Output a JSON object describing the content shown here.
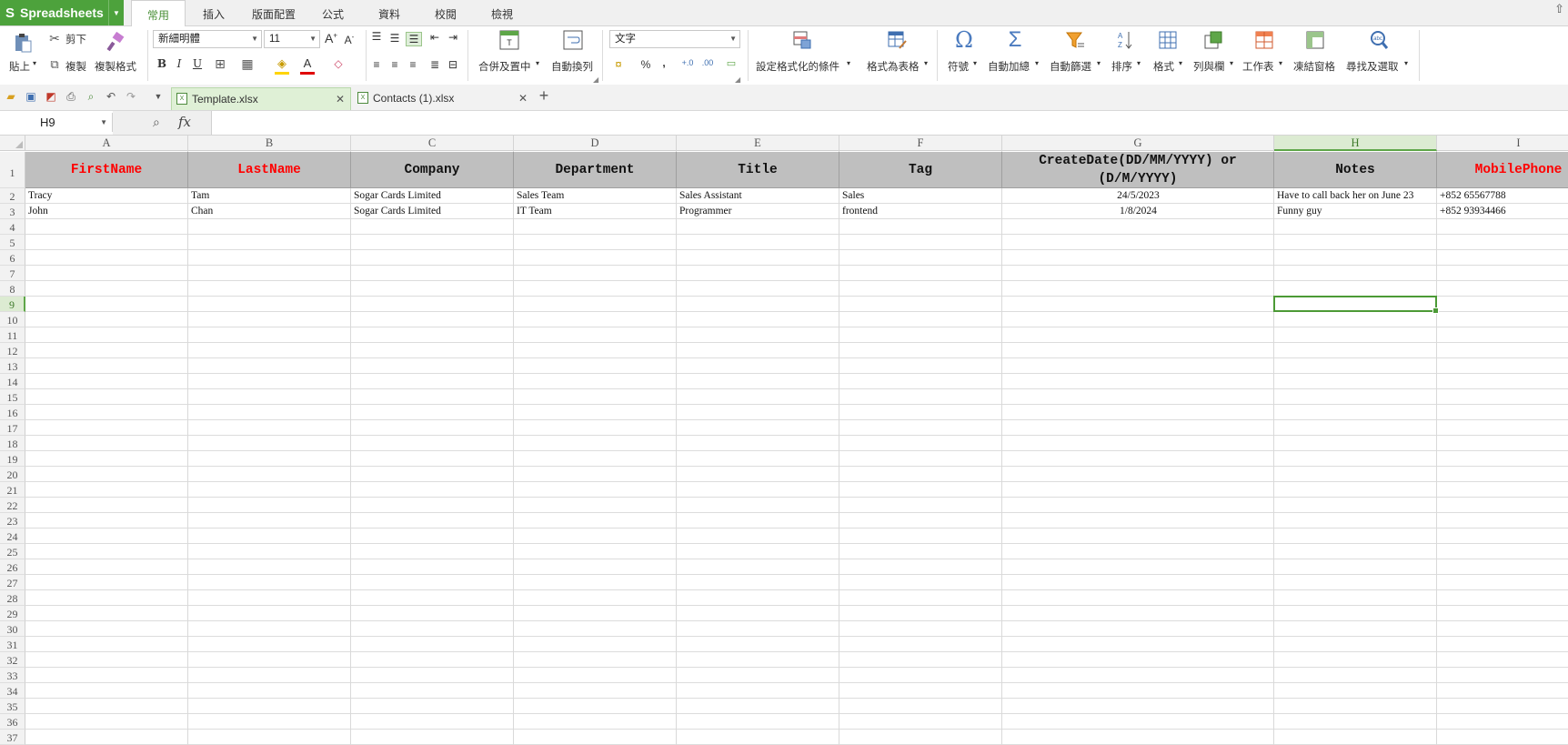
{
  "app": {
    "name": "Spreadsheets"
  },
  "menu_tabs": [
    "常用",
    "插入",
    "版面配置",
    "公式",
    "資料",
    "校閱",
    "檢視"
  ],
  "ribbon": {
    "paste": "貼上",
    "cut": "剪下",
    "copy": "複製",
    "format_painter": "複製格式",
    "font_name": "新細明體",
    "font_size": "11",
    "merge_center": "合併及置中",
    "wrap_text": "自動換列",
    "number_format": "文字",
    "percent": "%",
    "comma": ",",
    "conditional_format": "設定格式化的條件",
    "format_as_table": "格式為表格",
    "symbol": "符號",
    "autosum": "自動加總",
    "autofilter": "自動篩選",
    "sort": "排序",
    "format": "格式",
    "rows_cols": "列與欄",
    "worksheet": "工作表",
    "freeze": "凍結窗格",
    "find_select": "尋找及選取",
    "bold": "B",
    "italic": "I",
    "underline": "U"
  },
  "doc_tabs": [
    {
      "name": "Template.xlsx",
      "active": true
    },
    {
      "name": "Contacts (1).xlsx",
      "active": false
    }
  ],
  "formula_bar": {
    "name_box": "H9",
    "fx": "fx",
    "value": ""
  },
  "sheet": {
    "columns": [
      "A",
      "B",
      "C",
      "D",
      "E",
      "F",
      "G",
      "H",
      "I"
    ],
    "selected_column": "H",
    "selected_row": 9,
    "headers": [
      {
        "text": "FirstName",
        "red": true
      },
      {
        "text": "LastName",
        "red": true
      },
      {
        "text": "Company",
        "red": false
      },
      {
        "text": "Department",
        "red": false
      },
      {
        "text": "Title",
        "red": false
      },
      {
        "text": "Tag",
        "red": false
      },
      {
        "text": "CreateDate(DD/MM/YYYY) or (D/M/YYYY)",
        "red": false
      },
      {
        "text": "Notes",
        "red": false
      },
      {
        "text": "MobilePhone",
        "red": true
      }
    ],
    "rows": [
      [
        "Tracy",
        "Tam",
        "Sogar Cards Limited",
        "Sales Team",
        "Sales Assistant",
        "Sales",
        "24/5/2023",
        "Have to call back her on June 23",
        "+852 65567788"
      ],
      [
        "John",
        "Chan",
        "Sogar Cards Limited",
        "IT Team",
        "Programmer",
        "frontend",
        "1/8/2024",
        "Funny guy",
        "+852 93934466"
      ]
    ],
    "row_count": 37
  },
  "colors": {
    "brand": "#4da23c",
    "header_fill": "#bfbfbf",
    "required_header": "#ff0000",
    "selection": "#4c9a36"
  }
}
